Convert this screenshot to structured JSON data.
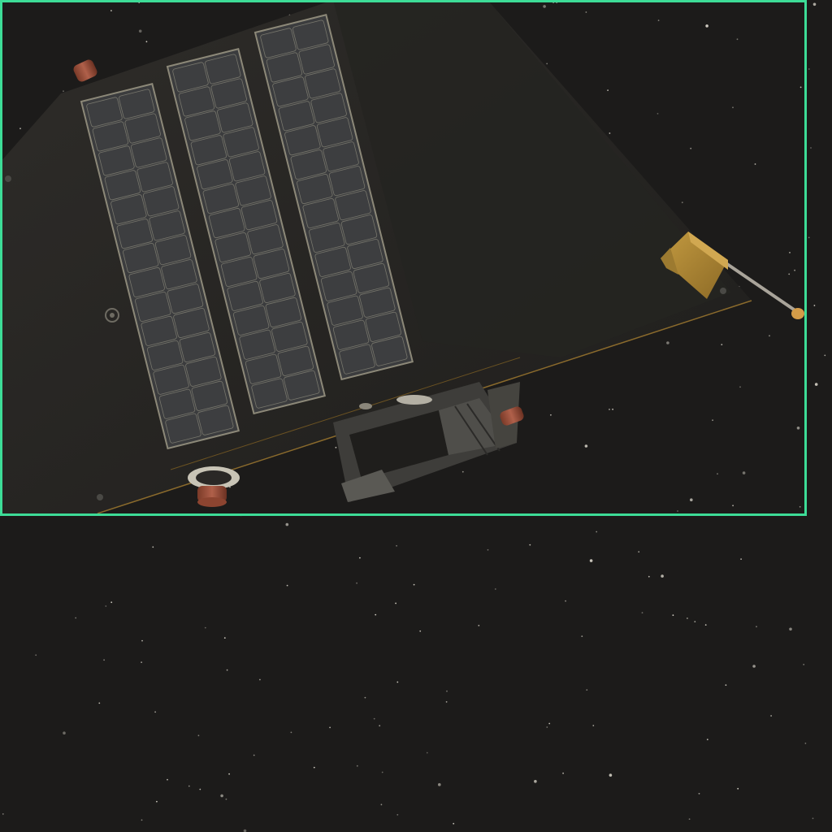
{
  "scene": {
    "subject": "satellite",
    "background": "starfield",
    "has_highlight_box": true,
    "highlight_box_target": "satellite"
  },
  "colors": {
    "space": "#1c1b1a",
    "bus_body": "#2a2826",
    "bus_edge": "#1a1918",
    "panel_frame": "#8c8878",
    "panel_cell": "#3b3c3e",
    "panel_cell_edge": "#77766c",
    "thruster_copper": "#a4553c",
    "antenna_gold": "#b48c36",
    "instrument_gray": "#4a4945",
    "highlight_box": "#3ddc97",
    "star": "#e8e4d8",
    "trim_line": "#8a6a2c"
  },
  "icons": {
    "solar_array": "solar-panel-icon",
    "thruster": "thruster-nozzle-icon",
    "antenna": "antenna-boom-icon"
  }
}
